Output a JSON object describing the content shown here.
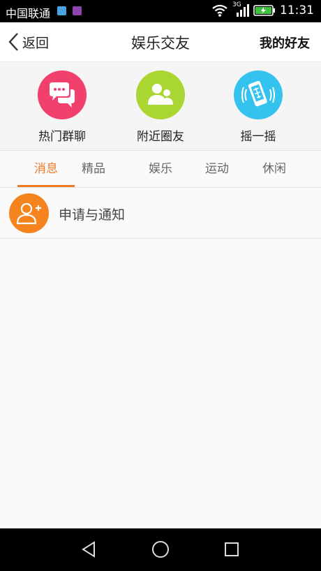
{
  "status_bar": {
    "carrier": "中国联通",
    "network": "3G",
    "time": "11:31",
    "icons": [
      "app-notification-icon",
      "app-notification-icon",
      "wifi-icon",
      "signal-icon",
      "battery-charging-icon"
    ]
  },
  "header": {
    "back_label": "返回",
    "title": "娱乐交友",
    "friends_label": "我的好友"
  },
  "quick_actions": [
    {
      "label": "热门群聊",
      "icon": "chat-bubbles-icon",
      "color": "#f0406b"
    },
    {
      "label": "附近圈友",
      "icon": "people-icon",
      "color": "#a9d632"
    },
    {
      "label": "摇一摇",
      "icon": "shake-phone-icon",
      "color": "#33c3ee"
    }
  ],
  "tabs": [
    "消息",
    "精品",
    "娱乐",
    "运动",
    "休闲"
  ],
  "active_tab": "消息",
  "accent_color": "#f07a23",
  "list": [
    {
      "label": "申请与通知",
      "icon": "add-user-icon",
      "color": "#f5841f"
    }
  ]
}
